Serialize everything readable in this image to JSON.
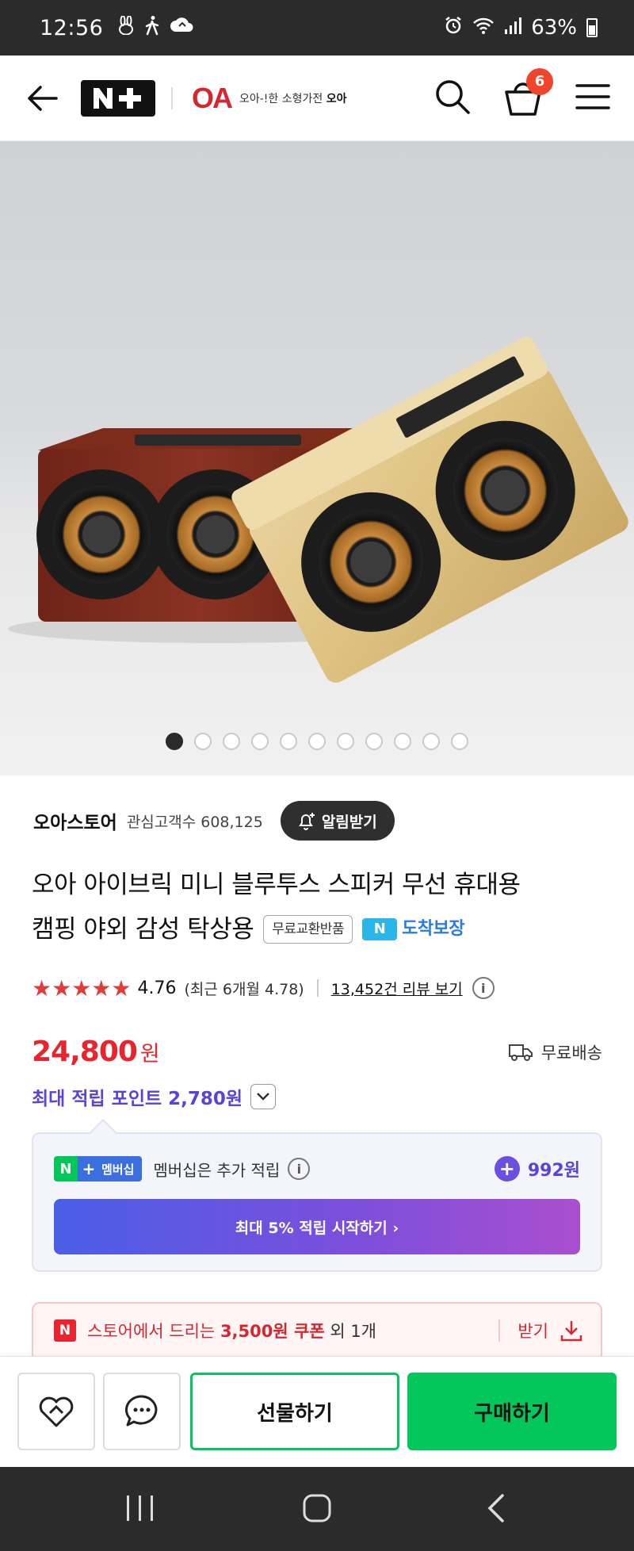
{
  "status_bar": {
    "time": "12:56",
    "battery": "63%"
  },
  "header": {
    "nplus_logo": "N+",
    "brand_logo": "OA",
    "brand_tagline": "오아-!한 소형가전",
    "brand_name": "오아",
    "cart_count": "6"
  },
  "gallery": {
    "total_images": 11,
    "active_index": 0,
    "image_description": "Two wooden bluetooth speakers"
  },
  "store": {
    "name": "오아스토어",
    "fans_label": "관심고객수 608,125",
    "alarm_button": "알림받기"
  },
  "product": {
    "title_line1": "오아 아이브릭 미니 블루투스 스피커 무선 휴대용",
    "title_line2": "캠핑 야외 감성 탁상용",
    "free_return_tag": "무료교환반품",
    "arrival_tag": "도착보장",
    "rating_score": "4.76",
    "rating_recent": "(최근 6개월 4.78)",
    "reviews_link": "13,452건 리뷰 보기",
    "rating_stars": 4.76
  },
  "price": {
    "amount": "24,800",
    "currency": "원",
    "shipping": "무료배송"
  },
  "points": {
    "label": "최대 적립 포인트 2,780원"
  },
  "membership": {
    "badge_text": "멤버십",
    "description": "멤버십은 추가 적립",
    "extra_points": "992원",
    "cta": "최대 5% 적립 시작하기 ›"
  },
  "coupon": {
    "prefix": "스토어에서 드리는",
    "amount": "3,500원 쿠폰",
    "suffix": "외 1개",
    "receive": "받기"
  },
  "actions": {
    "gift": "선물하기",
    "buy": "구매하기"
  },
  "colors": {
    "naver_green": "#03c75a",
    "price_red": "#e8252f",
    "points_purple": "#5a43d6"
  }
}
